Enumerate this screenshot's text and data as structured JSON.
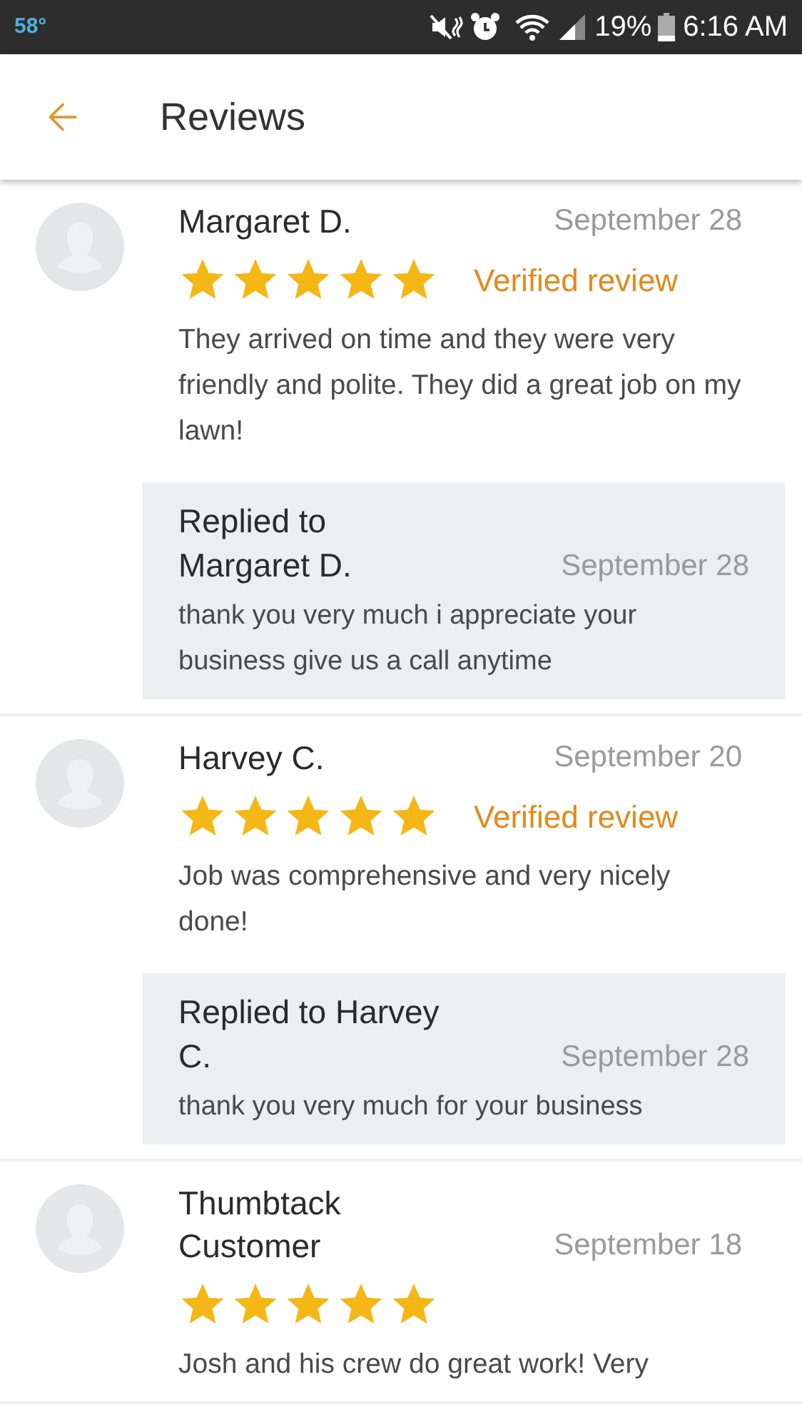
{
  "status_bar": {
    "temperature": "58°",
    "battery": "19%",
    "time": "6:16 AM"
  },
  "header": {
    "title": "Reviews"
  },
  "reviews": [
    {
      "name": "Margaret D.",
      "date": "September 28",
      "stars": 5,
      "badge": "Verified review",
      "text": "They arrived on time and they were very friendly and polite. They did a great job on my lawn!",
      "reply": {
        "title": "Replied to Margaret D.",
        "date": "September 28",
        "text": "thank you very much i appreciate your business give us a call anytime"
      }
    },
    {
      "name": "Harvey C.",
      "date": "September 20",
      "stars": 5,
      "badge": "Verified review",
      "text": "Job was comprehensive and very nicely done!",
      "reply": {
        "title": "Replied to Harvey C.",
        "date": "September 28",
        "text": "thank you very much for your business"
      }
    },
    {
      "name": "Thumbtack Customer",
      "date": "September 18",
      "stars": 5,
      "text": "Josh and his crew do great work!  Very"
    }
  ]
}
